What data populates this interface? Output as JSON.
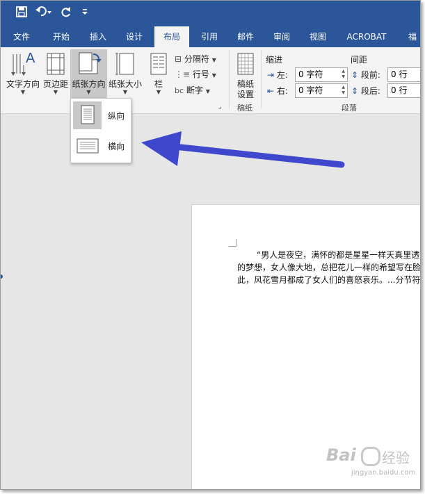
{
  "qat": {
    "icons": [
      "save-icon",
      "undo-icon",
      "redo-icon",
      "customize-icon"
    ]
  },
  "tabs": [
    "文件",
    "开始",
    "插入",
    "设计",
    "布局",
    "引用",
    "邮件",
    "审阅",
    "视图",
    "ACROBAT",
    "福"
  ],
  "active_tab": "布局",
  "ribbon": {
    "text_direction": "文字方向",
    "margins": "页边距",
    "orientation": "纸张方向",
    "size": "纸张大小",
    "columns": "栏",
    "breaks": "分隔符",
    "line_numbers": "行号",
    "hyphenation": "断字",
    "manuscript_line1": "稿纸",
    "manuscript_line2": "设置",
    "manuscript_group": "稿纸",
    "indent_title": "缩进",
    "spacing_title": "间距",
    "indent_left_label": "左:",
    "indent_left_value": "0 字符",
    "indent_right_label": "右:",
    "indent_right_value": "0 字符",
    "space_before_label": "段前:",
    "space_before_value": "0 行",
    "space_after_label": "段后:",
    "space_after_value": "0 行",
    "paragraph_group": "段落"
  },
  "orientation_menu": {
    "portrait": "纵向",
    "landscape": "横向"
  },
  "document": {
    "lines": [
      "“男人是夜空，满怀的都是星星一样天真里透",
      "的梦想，女人像大地，总把花儿一样的希望写在脸",
      "此，风花雪月都成了女人们的喜怒哀乐。...分节符"
    ]
  },
  "watermark": {
    "brand": "Bai",
    "brand2": "经验",
    "url": "jingyan.baidu.com"
  },
  "colors": {
    "accent": "#2b579a",
    "arrow": "#3f48cc",
    "ribbon": "#f3f3f3",
    "canvas": "#e6e6e6"
  }
}
